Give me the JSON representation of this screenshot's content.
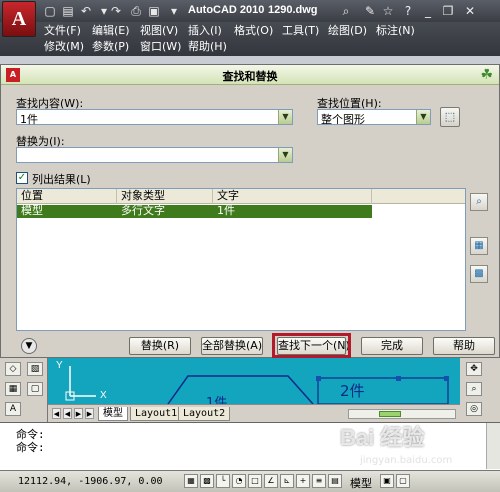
{
  "app": {
    "title": "AutoCAD 2010",
    "filename": "1290.dwg",
    "app_button_letter": "A"
  },
  "menu": {
    "row1": [
      "文件(F)",
      "编辑(E)",
      "视图(V)",
      "插入(I)",
      "格式(O)",
      "工具(T)",
      "绘图(D)",
      "标注(N)"
    ],
    "row2": [
      "修改(M)",
      "参数(P)",
      "窗口(W)",
      "帮助(H)"
    ]
  },
  "dialog": {
    "title": "查找和替换",
    "find_label": "查找内容(W):",
    "find_value": "1件",
    "find_where_label": "查找位置(H):",
    "find_where_value": "整个图形",
    "replace_label": "替换为(I):",
    "replace_value": "",
    "list_results_label": "列出结果(L)",
    "list_results_checked": true,
    "columns": [
      "位置",
      "对象类型",
      "文字"
    ],
    "rows": [
      {
        "location": "模型",
        "type": "多行文字",
        "text": "1件"
      }
    ],
    "buttons": {
      "replace": "替换(R)",
      "replace_all": "全部替换(A)",
      "find_next": "查找下一个(N)",
      "done": "完成",
      "help": "帮助"
    }
  },
  "drawing": {
    "label_1": "1件",
    "label_2": "2件",
    "axis_x": "X",
    "axis_y": "Y",
    "tabs": [
      "模型",
      "Layout1",
      "Layout2"
    ]
  },
  "command": {
    "line1": "命令:",
    "line2": "命令:"
  },
  "status": {
    "coords": "12112.94, -1906.97, 0.00",
    "model": "模型"
  },
  "watermark": {
    "brand": "Bai 经验",
    "url": "jingyan.baidu.com"
  },
  "colors": {
    "highlight_red": "#b31b2c",
    "selection_green": "#3f7a1c",
    "canvas_cyan": "#13a5bd"
  }
}
